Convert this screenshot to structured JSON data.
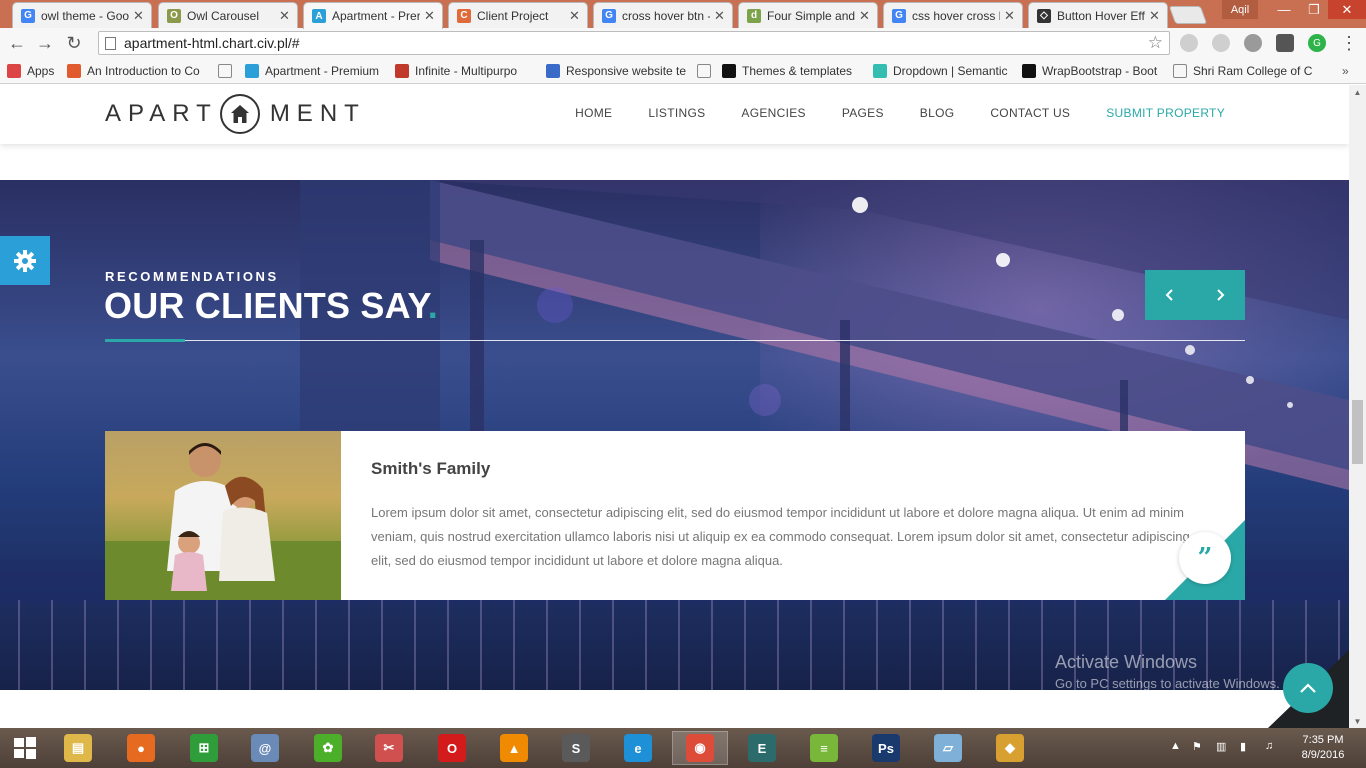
{
  "browser": {
    "tabs": [
      {
        "label": "owl theme - Goo",
        "favicon": "google-icon",
        "color": "#4285f4",
        "glyph": "G"
      },
      {
        "label": "Owl Carousel",
        "favicon": "owl-icon",
        "color": "#8a9a4a",
        "glyph": "O"
      },
      {
        "label": "Apartment - Prer",
        "favicon": "house-icon",
        "color": "#2a9fd8",
        "glyph": "A",
        "active": true
      },
      {
        "label": "Client Project",
        "favicon": "project-icon",
        "color": "#e06b3a",
        "glyph": "C"
      },
      {
        "label": "cross hover btn -",
        "favicon": "google-icon",
        "color": "#4285f4",
        "glyph": "G"
      },
      {
        "label": "Four Simple and",
        "favicon": "d-icon",
        "color": "#7ca34a",
        "glyph": "d"
      },
      {
        "label": "css hover cross b",
        "favicon": "google-icon",
        "color": "#4285f4",
        "glyph": "G"
      },
      {
        "label": "Button Hover Eff",
        "favicon": "codepen-icon",
        "color": "#333333",
        "glyph": "◇"
      }
    ],
    "user_name": "Aqil",
    "url": "apartment-html.chart.civ.pl/#",
    "bookmarks": [
      {
        "label": "Apps",
        "icon": "apps-grid-icon",
        "color": "#d44"
      },
      {
        "label": "An Introduction to Co",
        "icon": "plus-box-icon",
        "color": "#e25b2f"
      },
      {
        "label": "",
        "icon": "page-icon",
        "color": "#999"
      },
      {
        "label": "Apartment - Premium",
        "icon": "house-icon",
        "color": "#2a9fd8"
      },
      {
        "label": "Infinite - Multipurpo",
        "icon": "wp-icon",
        "color": "#c0392b"
      },
      {
        "label": "Responsive website te",
        "icon": "shield-icon",
        "color": "#3b6bc9"
      },
      {
        "label": "",
        "icon": "page-icon",
        "color": "#999"
      },
      {
        "label": "Themes & templates",
        "icon": "w-icon",
        "color": "#111"
      },
      {
        "label": "Dropdown | Semantic",
        "icon": "s-icon",
        "color": "#35bdb2"
      },
      {
        "label": "WrapBootstrap - Boot",
        "icon": "w-icon",
        "color": "#111"
      },
      {
        "label": "Shri Ram College of C",
        "icon": "page-icon",
        "color": "#999"
      }
    ]
  },
  "site": {
    "logo_left": "APART",
    "logo_right": "MENT",
    "nav": [
      {
        "label": "HOME"
      },
      {
        "label": "LISTINGS"
      },
      {
        "label": "AGENCIES"
      },
      {
        "label": "PAGES"
      },
      {
        "label": "BLOG"
      },
      {
        "label": "CONTACT US"
      },
      {
        "label": "SUBMIT PROPERTY",
        "accent": true
      }
    ],
    "accent_color": "#2aa8a8"
  },
  "testimonials": {
    "subtitle": "RECOMMENDATIONS",
    "title": "OUR CLIENTS SAY",
    "title_dot": ".",
    "card": {
      "name": "Smith's Family",
      "text": "Lorem ipsum dolor sit amet, consectetur adipiscing elit, sed do eiusmod tempor incididunt ut labore et dolore magna aliqua. Ut enim ad minim veniam, quis nostrud exercitation ullamco laboris nisi ut aliquip ex ea commodo consequat. Lorem ipsum dolor sit amet, consectetur adipiscing elit, sed do eiusmod tempor incididunt ut labore et dolore magna aliqua.",
      "quote_glyph": "”"
    }
  },
  "watermark": {
    "line1": "Activate Windows",
    "line2": "Go to PC settings to activate Windows."
  },
  "taskbar": {
    "apps": [
      {
        "name": "file-explorer-icon",
        "color": "#e0b84a",
        "glyph": "▤"
      },
      {
        "name": "firefox-icon",
        "color": "#e66a1f",
        "glyph": "●"
      },
      {
        "name": "store-icon",
        "color": "#2f9e3a",
        "glyph": "⊞"
      },
      {
        "name": "mail-icon",
        "color": "#6a8ab8",
        "glyph": "@"
      },
      {
        "name": "frog-icon",
        "color": "#4caf2a",
        "glyph": "✿"
      },
      {
        "name": "scissors-icon",
        "color": "#d05050",
        "glyph": "✂"
      },
      {
        "name": "opera-icon",
        "color": "#d41b1b",
        "glyph": "O"
      },
      {
        "name": "vlc-icon",
        "color": "#f08a00",
        "glyph": "▲"
      },
      {
        "name": "sublime-icon",
        "color": "#5a5a5a",
        "glyph": "S"
      },
      {
        "name": "ie-icon",
        "color": "#1e90d8",
        "glyph": "e"
      },
      {
        "name": "chrome-icon",
        "color": "#dd4b39",
        "glyph": "◉",
        "active": true
      },
      {
        "name": "editor-icon",
        "color": "#2b6b6b",
        "glyph": "E"
      },
      {
        "name": "stack-icon",
        "color": "#78b73a",
        "glyph": "≡"
      },
      {
        "name": "photoshop-icon",
        "color": "#1a3a6e",
        "glyph": "Ps"
      },
      {
        "name": "notes-icon",
        "color": "#7fb0d8",
        "glyph": "▱"
      },
      {
        "name": "puzzle-icon",
        "color": "#d8a030",
        "glyph": "◆"
      }
    ],
    "time": "7:35 PM",
    "date": "8/9/2016"
  }
}
